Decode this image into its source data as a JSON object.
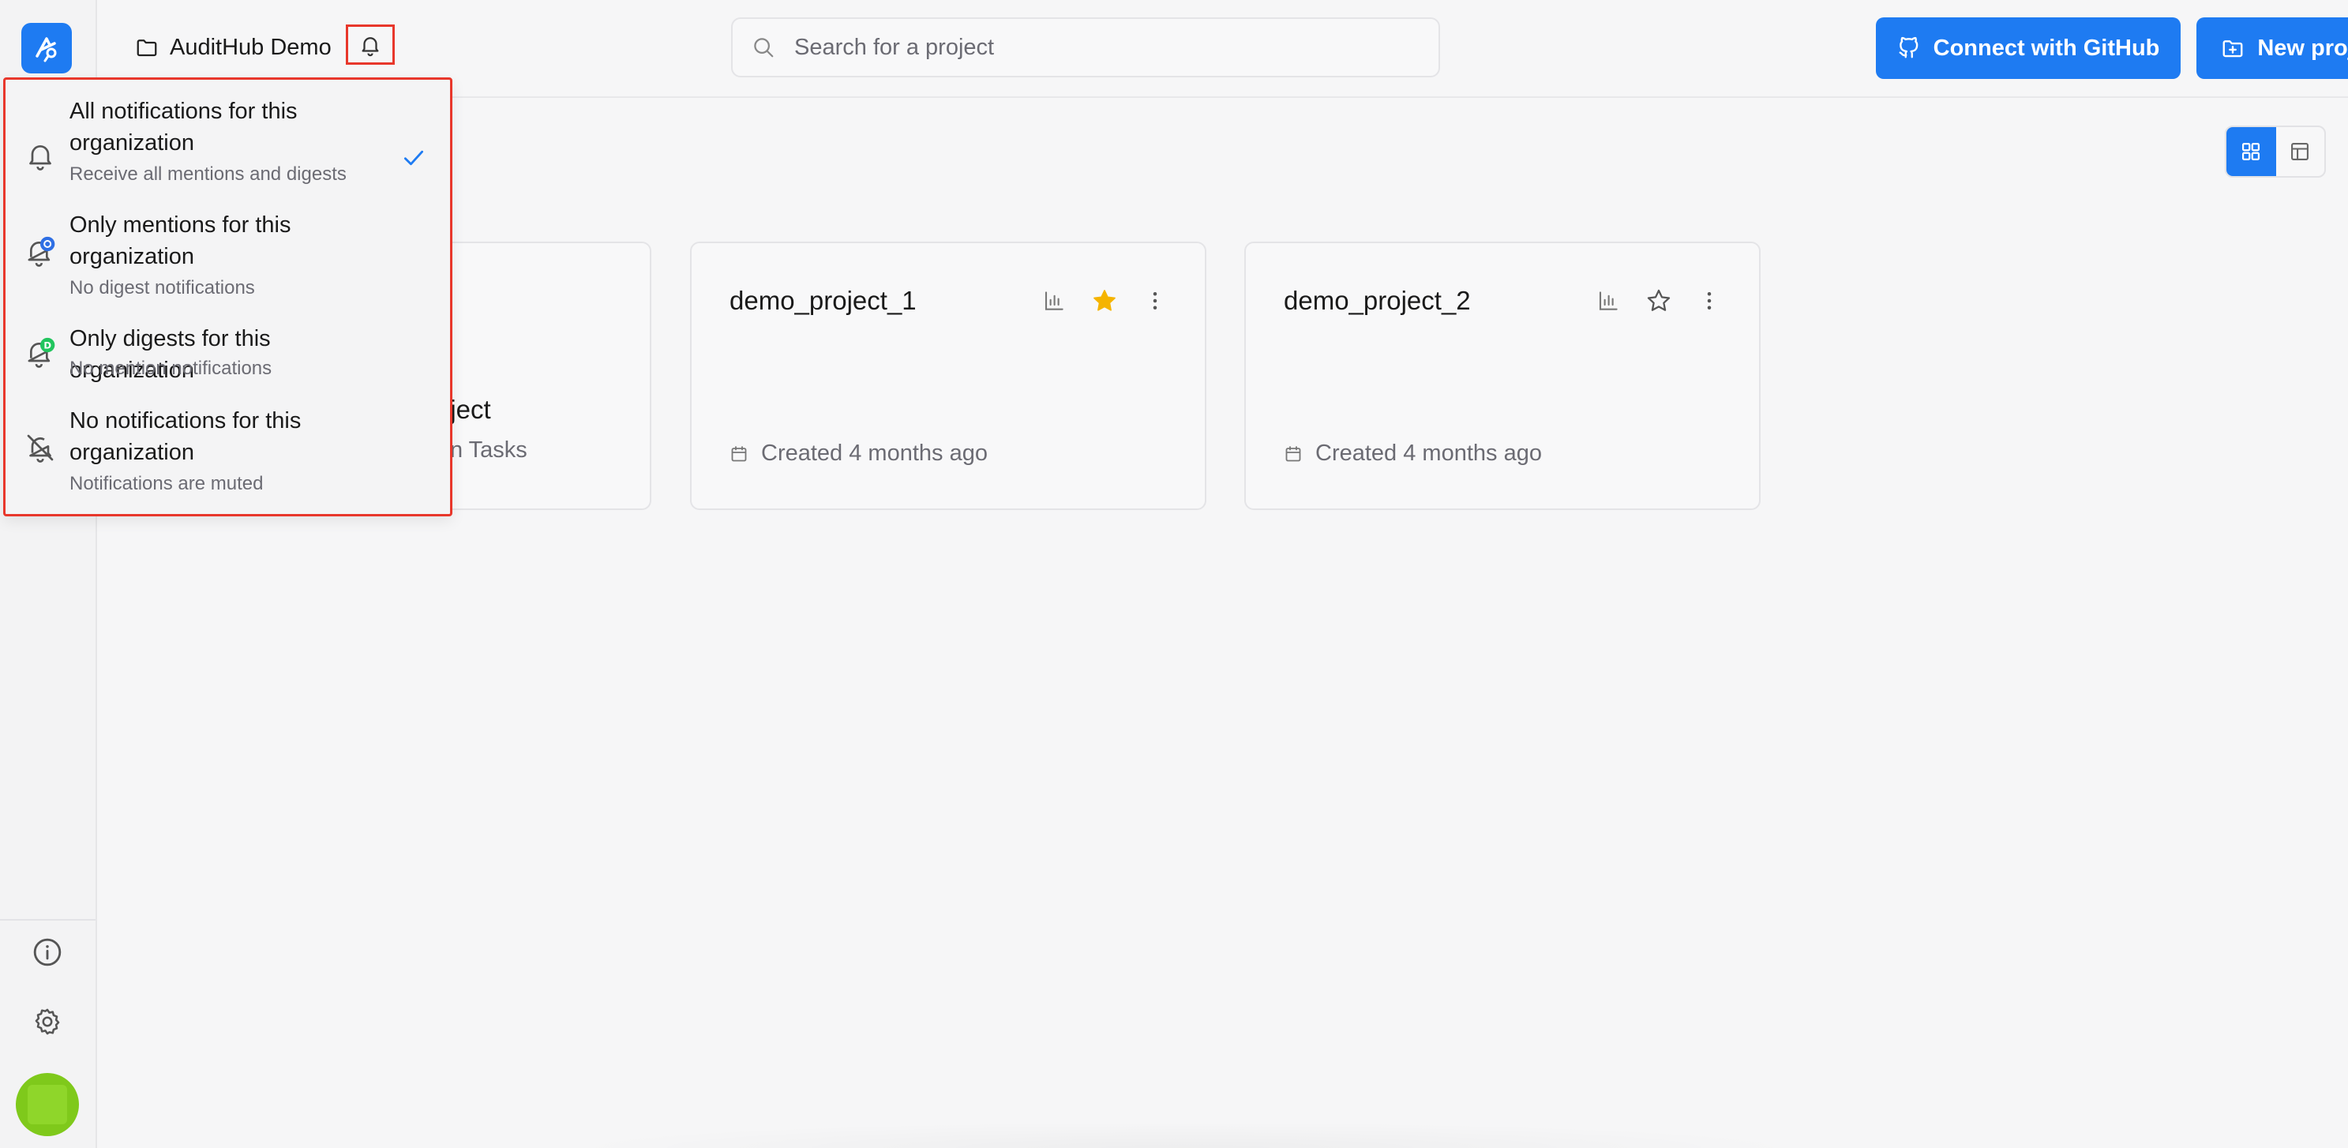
{
  "header": {
    "org_name": "AuditHub Demo",
    "search_placeholder": "Search for a project",
    "connect_github_label": "Connect with GitHub",
    "new_project_label": "New project"
  },
  "notification_menu": {
    "selected_index": 0,
    "items": [
      {
        "title": "All notifications for this organization",
        "description": "Receive all mentions and digests",
        "icon": "bell-icon"
      },
      {
        "title": "Only mentions for this organization",
        "description": "No digest notifications",
        "icon": "bell-mention-icon"
      },
      {
        "title": "Only digests for this organization",
        "description": "No mention notifications",
        "icon": "bell-digest-icon"
      },
      {
        "title": "No notifications for this organization",
        "description": "Notifications are muted",
        "icon": "bell-off-icon"
      }
    ]
  },
  "projects": [
    {
      "title_fragment": "oject",
      "subtitle_fragment": "n Tasks"
    },
    {
      "name": "demo_project_1",
      "starred": true,
      "created": "Created 4 months ago"
    },
    {
      "name": "demo_project_2",
      "starred": false,
      "created": "Created 4 months ago"
    }
  ],
  "colors": {
    "accent": "#1e7bf2",
    "highlight_border": "#e8372b",
    "star_filled": "#f5b400",
    "digest_badge": "#22c55e",
    "avatar": "#7fc91b"
  }
}
